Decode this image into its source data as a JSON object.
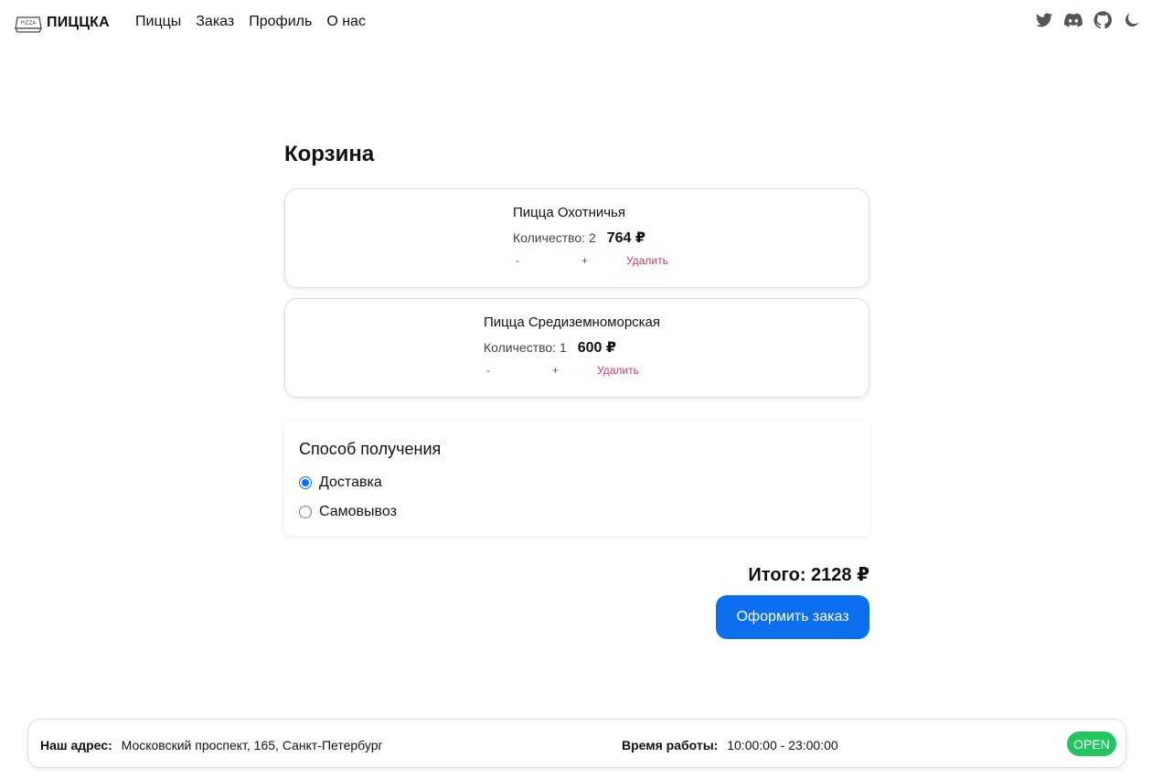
{
  "header": {
    "logo_text": "PIZZA",
    "brand": "ПИЦЦКА",
    "nav": [
      {
        "label": "Пиццы"
      },
      {
        "label": "Заказ"
      },
      {
        "label": "Профиль"
      },
      {
        "label": "О нас"
      }
    ],
    "icons": [
      "twitter-icon",
      "discord-icon",
      "github-icon",
      "moon-icon"
    ]
  },
  "cart": {
    "title": "Корзина",
    "items": [
      {
        "name": "Пицца Охотничья",
        "quantity_label": "Количество: 2",
        "quantity": 2,
        "price": "764 ₽",
        "minus": "-",
        "plus": "+",
        "remove": "Удалить"
      },
      {
        "name": "Пицца Средиземноморская",
        "quantity_label": "Количество: 1",
        "quantity": 1,
        "price": "600 ₽",
        "minus": "-",
        "plus": "+",
        "remove": "Удалить"
      }
    ]
  },
  "delivery": {
    "title": "Способ получения",
    "options": [
      {
        "label": "Доставка",
        "checked": true
      },
      {
        "label": "Самовывоз",
        "checked": false
      }
    ]
  },
  "summary": {
    "total": "Итого: 2128 ₽",
    "submit_label": "Оформить заказ"
  },
  "footer": {
    "address_label": "Наш адрес:",
    "address": "Московский проспект, 165, Санкт-Петербург",
    "hours_label": "Время работы:",
    "hours": "10:00:00 - 23:00:00",
    "status": "OPEN"
  },
  "colors": {
    "accent": "#0b6ff0",
    "remove": "#d6336c",
    "status_open": "#22c55e"
  }
}
